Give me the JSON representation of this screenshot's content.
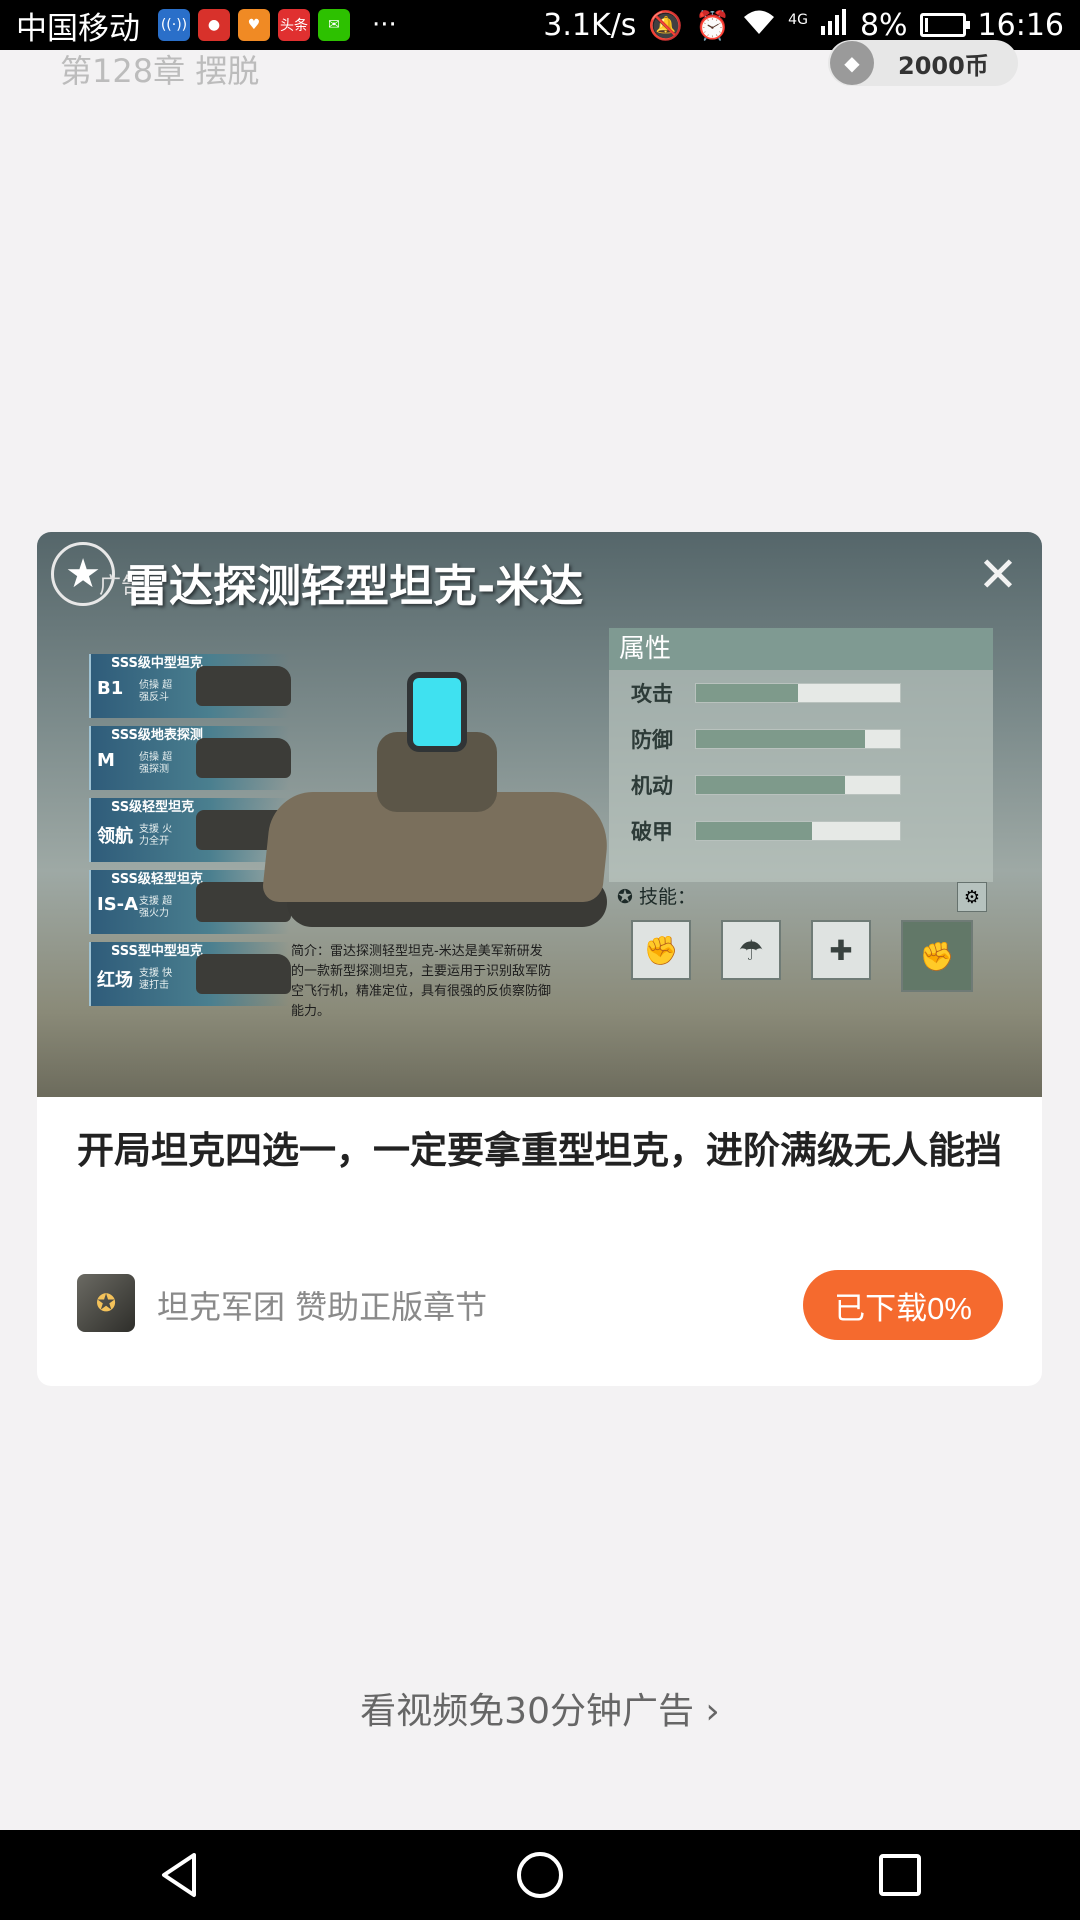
{
  "status_bar": {
    "carrier": "中国移动",
    "app_icons": [
      {
        "name": "signal-app-icon",
        "color": "#2a6fc9",
        "glyph": "((·))"
      },
      {
        "name": "red-app-icon",
        "color": "#d8312b",
        "glyph": "●"
      },
      {
        "name": "orange-app-icon",
        "color": "#f08a24",
        "glyph": "♥"
      },
      {
        "name": "toutiao-app-icon",
        "color": "#e03030",
        "glyph": "头条"
      },
      {
        "name": "wechat-app-icon",
        "color": "#2dc100",
        "glyph": "✉"
      }
    ],
    "more": "···",
    "net_speed": "3.1K/s",
    "network_label": "4G",
    "battery": "8%",
    "battery_level": 0.08,
    "time": "16:16"
  },
  "chapter": {
    "title": "第128章 摆脱",
    "coins": "2000币"
  },
  "ad": {
    "label": "广告",
    "image": {
      "title": "雷达探测轻型坦克-米达",
      "tanks": [
        {
          "name": "SSS级中型坦克",
          "code": "B1",
          "sub": "侦操 超强反斗"
        },
        {
          "name": "SSS级地表探测",
          "code": "M",
          "sub": "侦操 超强探测"
        },
        {
          "name": "SS级轻型坦克",
          "code": "领航",
          "sub": "支援 火力全开"
        },
        {
          "name": "SSS级轻型坦克",
          "code": "IS-A",
          "sub": "支援 超强火力"
        },
        {
          "name": "SSS型中型坦克",
          "code": "红场",
          "sub": "支援 快速打击"
        }
      ],
      "intro": "简介：雷达探测轻型坦克-米达是美军新研发的一款新型探测坦克，主要运用于识别敌军防空飞行机，精准定位，具有很强的反侦察防御能力。",
      "attr_title": "属性",
      "attributes": [
        {
          "label": "攻击",
          "value": 0.5
        },
        {
          "label": "防御",
          "value": 0.83
        },
        {
          "label": "机动",
          "value": 0.73
        },
        {
          "label": "破甲",
          "value": 0.57
        }
      ],
      "skill_label": "✪ 技能："
    },
    "headline": "开局坦克四选一，一定要拿重型坦克，进阶满级无人能挡",
    "sponsor": "坦克军团 赞助正版章节",
    "download_button": "已下载0%"
  },
  "video_link": "看视频免30分钟广告 ›"
}
